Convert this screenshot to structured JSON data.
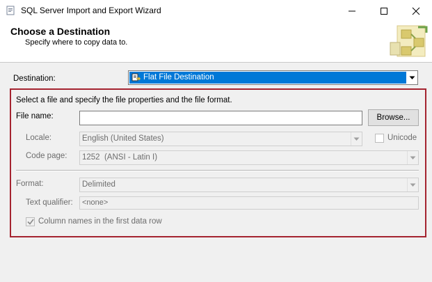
{
  "window": {
    "title": "SQL Server Import and Export Wizard"
  },
  "header": {
    "title": "Choose a Destination",
    "subtitle": "Specify where to copy data to."
  },
  "destination": {
    "label": "Destination:",
    "selected": "Flat File Destination",
    "icon": "flat-file-destination-icon"
  },
  "file_props": {
    "instruction": "Select a file and specify the file properties and the file format.",
    "file_name_label": "File name:",
    "file_name_value": "",
    "browse_label": "Browse...",
    "locale_label": "Locale:",
    "locale_value": "English (United States)",
    "unicode_label": "Unicode",
    "unicode_checked": false,
    "codepage_label": "Code page:",
    "codepage_value": "1252  (ANSI - Latin I)",
    "format_label": "Format:",
    "format_value": "Delimited",
    "text_qualifier_label": "Text qualifier:",
    "text_qualifier_value": "<none>",
    "column_names_label": "Column names in the first data row",
    "column_names_checked": true
  },
  "colors": {
    "selection": "#0078d7",
    "frame": "#a4232f",
    "disabled_text": "#6d6d6d",
    "panel_bg": "#f0f0f0"
  }
}
